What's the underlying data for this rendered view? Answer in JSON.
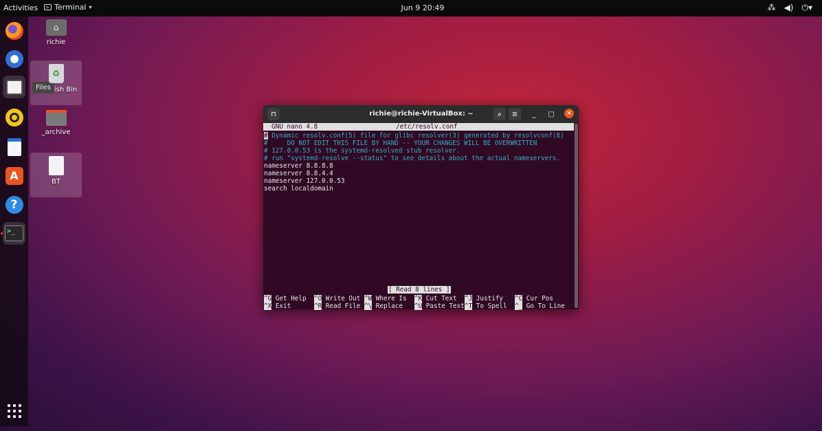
{
  "topbar": {
    "activities": "Activities",
    "app_menu": "Terminal",
    "clock": "Jun 9  20:49",
    "tray": [
      "network-icon",
      "volume-icon",
      "power-icon"
    ]
  },
  "dock": {
    "tooltip": "Files",
    "items": [
      {
        "name": "firefox",
        "icon": "firefox-icon"
      },
      {
        "name": "thunderbird",
        "icon": "thunderbird-icon"
      },
      {
        "name": "files",
        "icon": "files-icon"
      },
      {
        "name": "rhythmbox",
        "icon": "rhythmbox-icon"
      },
      {
        "name": "writer",
        "icon": "writer-icon"
      },
      {
        "name": "software",
        "icon": "software-icon",
        "glyph": "A"
      },
      {
        "name": "help",
        "icon": "help-icon",
        "glyph": "?"
      },
      {
        "name": "terminal",
        "icon": "terminal-icon",
        "glyph": ">_"
      }
    ],
    "show_apps_icon": "apps-grid-icon"
  },
  "desktop": {
    "icons": [
      {
        "label": "richie",
        "icon": "home-folder-icon"
      },
      {
        "label": "ish Bin",
        "icon": "trash-icon"
      },
      {
        "label": "_archive",
        "icon": "folder-icon"
      },
      {
        "label": "BT",
        "icon": "document-icon"
      }
    ]
  },
  "window": {
    "title": "richie@richie-VirtualBox: ~",
    "buttons": {
      "new_tab_icon": "new-tab-icon",
      "search_icon": "search-icon",
      "menu_icon": "hamburger-icon",
      "minimize": "_",
      "maximize": "□",
      "close": "×"
    }
  },
  "nano": {
    "version": "GNU nano 4.8",
    "filename": "/etc/resolv.conf",
    "lines": [
      {
        "text": "# Dynamic resolv.conf(5) file for glibc resolver(3) generated by resolvconf(8)",
        "comment": true
      },
      {
        "text": "#     DO NOT EDIT THIS FILE BY HAND -- YOUR CHANGES WILL BE OVERWRITTEN",
        "comment": true
      },
      {
        "text": "# 127.0.0.53 is the systemd-resolved stub resolver.",
        "comment": true
      },
      {
        "text": "# run \"systemd-resolve --status\" to see details about the actual nameservers.",
        "comment": true
      },
      {
        "text": "nameserver 8.8.8.8",
        "comment": false
      },
      {
        "text": "nameserver 8.8.4.4",
        "comment": false
      },
      {
        "text": "nameserver 127.0.0.53",
        "comment": false
      },
      {
        "text": "search localdomain",
        "comment": false
      }
    ],
    "status": "[ Read 8 lines ]",
    "shortcuts_row1": [
      {
        "key": "^G",
        "label": "Get Help"
      },
      {
        "key": "^O",
        "label": "Write Out"
      },
      {
        "key": "^W",
        "label": "Where Is"
      },
      {
        "key": "^K",
        "label": "Cut Text"
      },
      {
        "key": "^J",
        "label": "Justify"
      },
      {
        "key": "^C",
        "label": "Cur Pos"
      }
    ],
    "shortcuts_row2": [
      {
        "key": "^X",
        "label": "Exit"
      },
      {
        "key": "^R",
        "label": "Read File"
      },
      {
        "key": "^\\",
        "label": "Replace"
      },
      {
        "key": "^U",
        "label": "Paste Text"
      },
      {
        "key": "^T",
        "label": "To Spell"
      },
      {
        "key": "^_",
        "label": "Go To Line"
      }
    ]
  }
}
